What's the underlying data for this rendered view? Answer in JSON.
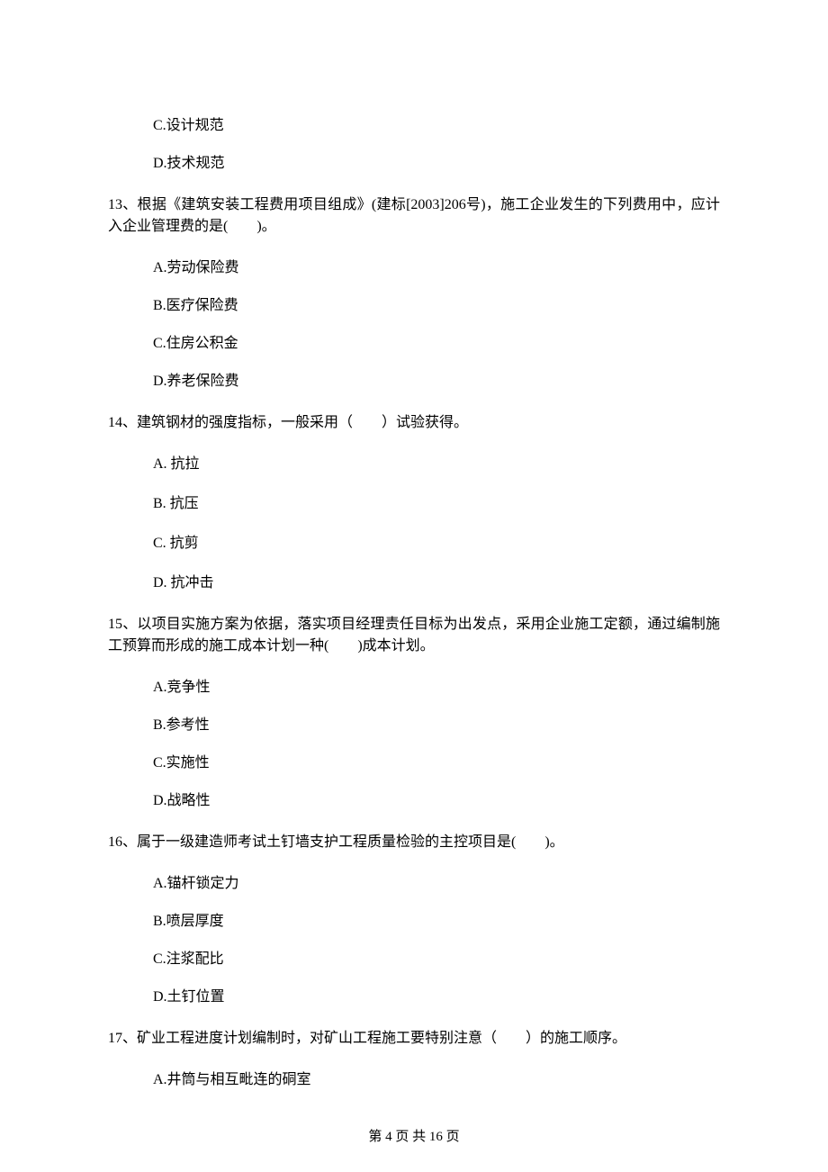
{
  "orphan_options": {
    "c": "C.设计规范",
    "d": "D.技术规范"
  },
  "q13": {
    "stem": "13、根据《建筑安装工程费用项目组成》(建标[2003]206号)，施工企业发生的下列费用中，应计入企业管理费的是(　　)。",
    "a": "A.劳动保险费",
    "b": "B.医疗保险费",
    "c": "C.住房公积金",
    "d": "D.养老保险费"
  },
  "q14": {
    "stem": "14、建筑钢材的强度指标，一般采用（　　）试验获得。",
    "a": "A.  抗拉",
    "b": "B.  抗压",
    "c": "C.  抗剪",
    "d": "D.  抗冲击"
  },
  "q15": {
    "stem": "15、以项目实施方案为依据，落实项目经理责任目标为出发点，采用企业施工定额，通过编制施工预算而形成的施工成本计划一种(　　)成本计划。",
    "a": "A.竞争性",
    "b": "B.参考性",
    "c": "C.实施性",
    "d": "D.战略性"
  },
  "q16": {
    "stem": "16、属于一级建造师考试土钉墙支护工程质量检验的主控项目是(　　)。",
    "a": "A.锚杆锁定力",
    "b": "B.喷层厚度",
    "c": "C.注浆配比",
    "d": "D.土钉位置"
  },
  "q17": {
    "stem": "17、矿业工程进度计划编制时，对矿山工程施工要特别注意（　　）的施工顺序。",
    "a": "A.井筒与相互毗连的硐室"
  },
  "footer": "第 4 页 共 16 页"
}
